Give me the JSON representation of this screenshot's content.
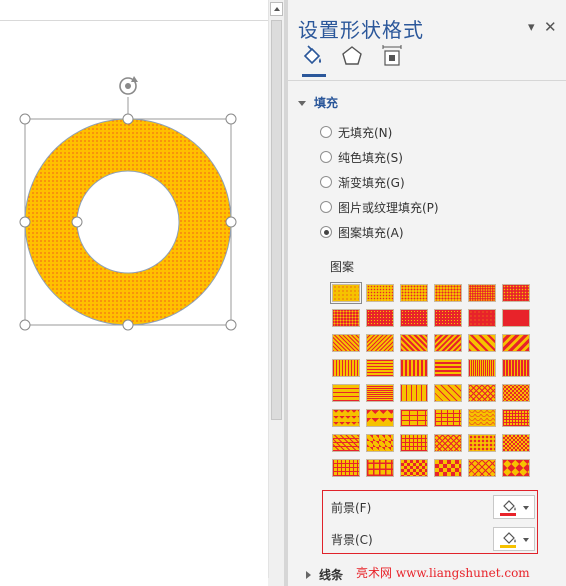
{
  "panel": {
    "title": "设置形状格式",
    "tabs": [
      "fill-line",
      "effects",
      "size-properties"
    ],
    "fill_section": {
      "header": "填充",
      "options": [
        {
          "label": "无填充(N)",
          "checked": false
        },
        {
          "label": "纯色填充(S)",
          "checked": false
        },
        {
          "label": "渐变填充(G)",
          "checked": false
        },
        {
          "label": "图片或纹理填充(P)",
          "checked": false
        },
        {
          "label": "图案填充(A)",
          "checked": true
        }
      ],
      "pattern_label": "图案",
      "foreground_label": "前景(F)",
      "background_label": "背景(C)",
      "foreground_color": "#e8232a",
      "background_color": "#f6c200"
    },
    "line_section": {
      "header": "线条"
    }
  },
  "shape": {
    "type": "donut",
    "fill_color": "#ffc000",
    "dot_color": "#e8232a",
    "outline_color": "#8da0b8"
  },
  "watermark": "亮术网 www.liangshunet.com"
}
